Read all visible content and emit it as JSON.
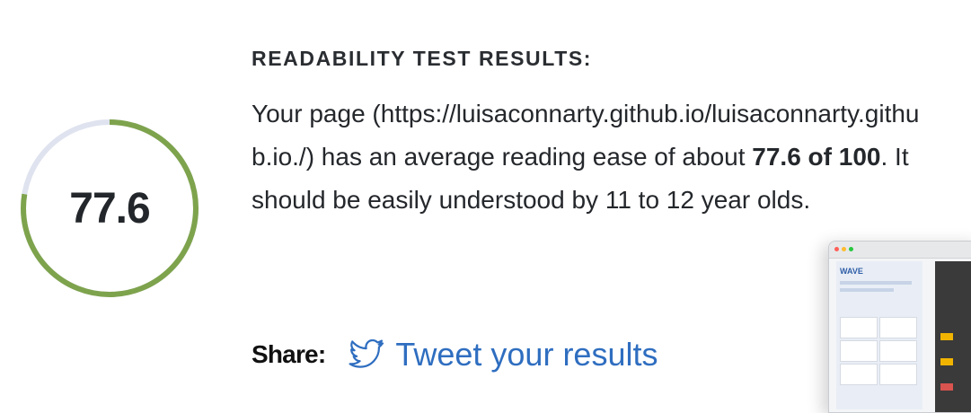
{
  "score": {
    "value": "77.6",
    "fraction": 0.776,
    "track_color": "#dfe3ef",
    "fill_color": "#7ea34d"
  },
  "results": {
    "heading": "READABILITY TEST RESULTS:",
    "intro": "Your page (https://luisaconnarty.github.io/luisaconnarty.github.io./) has an average reading ease of about ",
    "score_text": "77.6 of 100",
    "outro": ". It should be easily understood by 11 to 12 year olds."
  },
  "share": {
    "label": "Share:",
    "tweet_label": "Tweet your results",
    "icon": "twitter-bird-icon",
    "link_color": "#2f6ec0"
  },
  "thumbnail": {
    "logo": "WAVE"
  }
}
